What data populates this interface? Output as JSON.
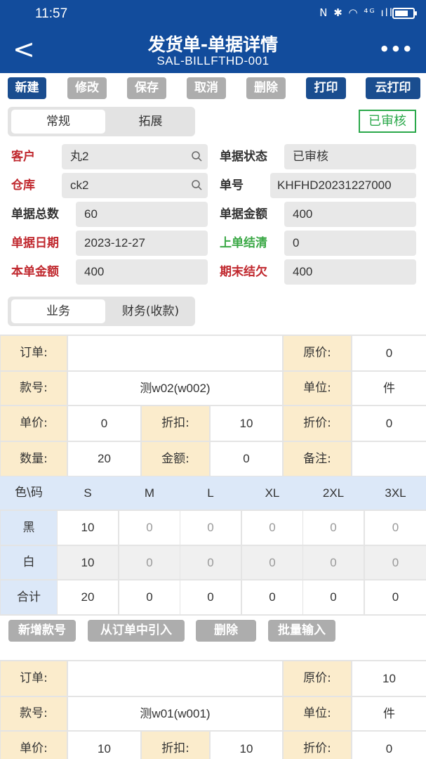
{
  "status_bar": {
    "time": "11:57",
    "icons": "N ✱ ◠ ⁴ᴳ ıll"
  },
  "header": {
    "title": "发货单-单据详情",
    "subtitle": "SAL-BILLFTHD-001",
    "back_glyph": "<",
    "more_glyph": "•••"
  },
  "toolbar": {
    "buttons": [
      {
        "label": "新建",
        "enabled": true
      },
      {
        "label": "修改",
        "enabled": false
      },
      {
        "label": "保存",
        "enabled": false
      },
      {
        "label": "取消",
        "enabled": false
      },
      {
        "label": "删除",
        "enabled": false
      },
      {
        "label": "打印",
        "enabled": true
      },
      {
        "label": "云打印",
        "enabled": true
      }
    ]
  },
  "main_tabs": {
    "items": [
      "常规",
      "拓展"
    ],
    "active": 0
  },
  "audit_badge": "已审核",
  "form": {
    "customer": {
      "label": "客户",
      "value": "丸2"
    },
    "status": {
      "label": "单据状态",
      "value": "已审核"
    },
    "warehouse": {
      "label": "仓库",
      "value": "ck2"
    },
    "bill_no": {
      "label": "单号",
      "value": "KHFHD20231227000"
    },
    "total_qty": {
      "label": "单据总数",
      "value": "60"
    },
    "total_amount": {
      "label": "单据金额",
      "value": "400"
    },
    "bill_date": {
      "label": "单据日期",
      "value": "2023-12-27"
    },
    "prev_balance": {
      "label": "上单结清",
      "value": "0"
    },
    "this_amount": {
      "label": "本单金额",
      "value": "400"
    },
    "end_balance": {
      "label": "期末结欠",
      "value": "400"
    }
  },
  "sub_tabs": {
    "items": [
      "业务",
      "财务(收款)"
    ],
    "active": 0
  },
  "labels": {
    "order": "订单:",
    "orig_price": "原价:",
    "style_no": "款号:",
    "unit": "单位:",
    "unit_price": "单价:",
    "discount": "折扣:",
    "disc_price": "折价:",
    "quantity": "数量:",
    "amount": "金额:",
    "remark": "备注:",
    "color_size": "色\\码",
    "total": "合计"
  },
  "items": [
    {
      "order": "",
      "orig_price": "0",
      "style_no": "测w02(w002)",
      "unit": "件",
      "unit_price": "0",
      "discount": "10",
      "disc_price": "0",
      "quantity": "20",
      "amount": "0",
      "remark": "",
      "sizes": [
        "S",
        "M",
        "L",
        "XL",
        "2XL",
        "3XL"
      ],
      "rows": [
        {
          "color": "黑",
          "values": [
            "10",
            "0",
            "0",
            "0",
            "0",
            "0"
          ]
        },
        {
          "color": "白",
          "values": [
            "10",
            "0",
            "0",
            "0",
            "0",
            "0"
          ]
        }
      ],
      "totals": [
        "20",
        "0",
        "0",
        "0",
        "0",
        "0"
      ]
    },
    {
      "order": "",
      "orig_price": "10",
      "style_no": "测w01(w001)",
      "unit": "件",
      "unit_price": "10",
      "discount": "10",
      "disc_price": "0"
    }
  ],
  "actions": [
    "新增款号",
    "从订单中引入",
    "删除",
    "批量输入"
  ],
  "colors": {
    "header_bg": "#124c9c",
    "primary_btn": "#1a4d8f",
    "disabled_btn": "#adadad",
    "label_bg": "#fbeccc",
    "size_header_bg": "#dce8f8",
    "required": "#c0282e",
    "success": "#2aa84a"
  }
}
